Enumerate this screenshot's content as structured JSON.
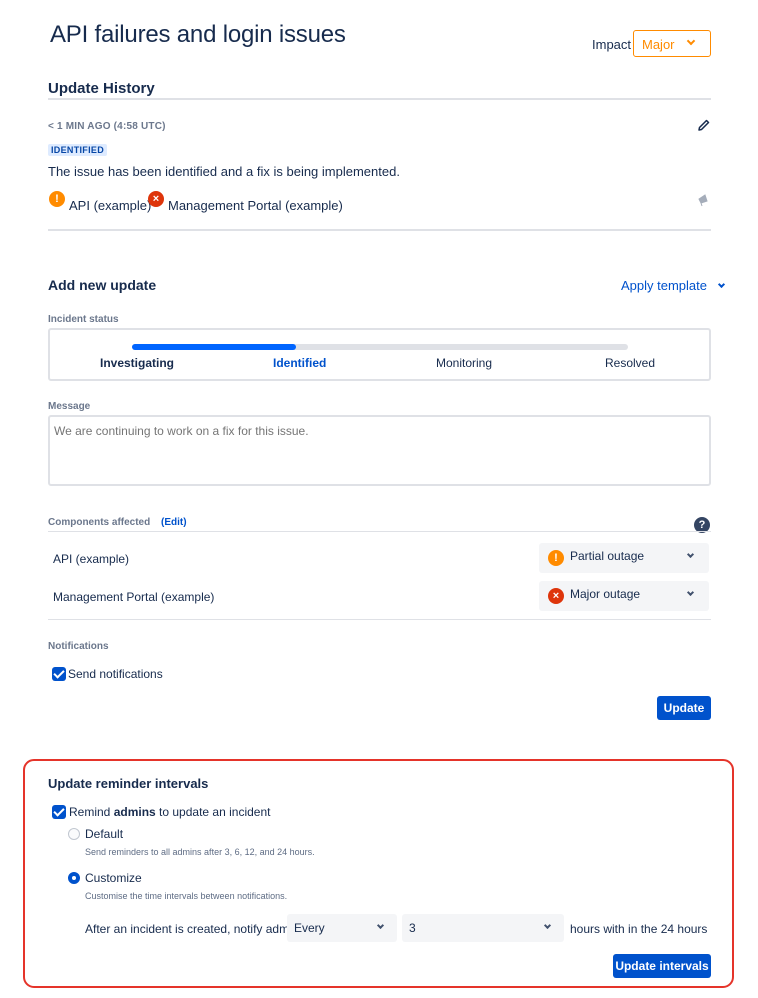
{
  "incident": {
    "title": "API failures and login issues",
    "impact_label": "Impact",
    "impact_value": "Major"
  },
  "history": {
    "heading": "Update History",
    "timestamp": "< 1 MIN AGO (4:58 UTC)",
    "status_badge": "IDENTIFIED",
    "message": "The issue has been identified and a fix is being implemented.",
    "components": [
      {
        "name": "API (example)",
        "status": "partial",
        "icon": "!"
      },
      {
        "name": "Management Portal (example)",
        "status": "major",
        "icon": "×"
      }
    ]
  },
  "new_update": {
    "heading": "Add new update",
    "apply_template": "Apply template",
    "status_label": "Incident status",
    "statuses": [
      "Investigating",
      "Identified",
      "Monitoring",
      "Resolved"
    ],
    "selected_status": "Identified",
    "progress_fraction": 0.33,
    "message_label": "Message",
    "message_placeholder": "We are continuing to work on a fix for this issue.",
    "components_label": "Components affected",
    "edit_label": "(Edit)",
    "components": [
      {
        "name": "API (example)",
        "status": "Partial outage",
        "icon": "!"
      },
      {
        "name": "Management Portal (example)",
        "status": "Major outage",
        "icon": "×"
      }
    ],
    "notifications_label": "Notifications",
    "send_notifications": "Send notifications",
    "update_button": "Update"
  },
  "reminders": {
    "heading": "Update reminder intervals",
    "remind_prefix": "Remind ",
    "remind_bold": "admins",
    "remind_suffix": " to update an incident",
    "default_label": "Default",
    "default_desc": "Send reminders to all admins after 3, 6, 12, and 24 hours.",
    "customize_label": "Customize",
    "customize_desc": "Customise the time intervals between notifications.",
    "notify_prefix": "After an incident is created, notify admins",
    "every_value": "Every",
    "hours_value": "3",
    "notify_suffix": "hours with in the 24 hours",
    "update_intervals_button": "Update intervals"
  },
  "colors": {
    "accent": "#0052cc",
    "impact_major": "#ff8b00",
    "highlight_border": "#e5342a",
    "partial_outage": "#ff8b00",
    "major_outage": "#de350b"
  }
}
